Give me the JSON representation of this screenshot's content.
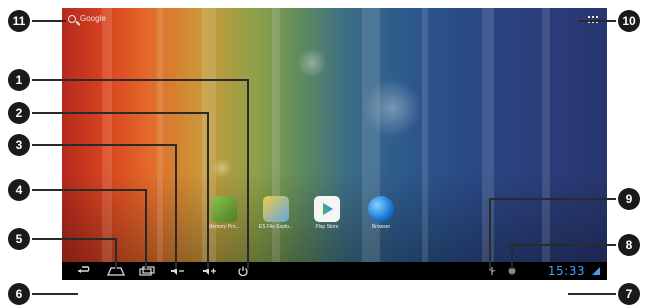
{
  "search": {
    "label": "Google"
  },
  "apps": [
    {
      "label": "Memory Pro..."
    },
    {
      "label": "ES File Explo..."
    },
    {
      "label": "Play Store"
    },
    {
      "label": "Browser"
    }
  ],
  "status": {
    "clock": "15:33"
  },
  "callouts": [
    "1",
    "2",
    "3",
    "4",
    "5",
    "6",
    "7",
    "8",
    "9",
    "10",
    "11"
  ]
}
